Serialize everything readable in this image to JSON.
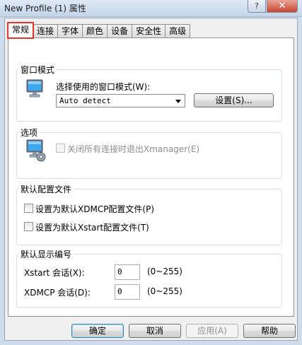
{
  "window": {
    "title": "New Profile (1) 属性",
    "help_button": "?",
    "close_button": "✕"
  },
  "tabs": [
    {
      "label": "常规"
    },
    {
      "label": "连接"
    },
    {
      "label": "字体"
    },
    {
      "label": "颜色"
    },
    {
      "label": "设备"
    },
    {
      "label": "安全性"
    },
    {
      "label": "高级"
    }
  ],
  "active_tab": "常规",
  "window_mode": {
    "group_label": "窗口模式",
    "select_label": "选择使用的窗口模式(W):",
    "select_value": "Auto detect",
    "settings_button": "设置(S)..."
  },
  "options": {
    "group_label": "选项",
    "exit_checkbox_label": "关闭所有连接时退出Xmanager(E)",
    "exit_checkbox_checked": false,
    "exit_checkbox_enabled": false
  },
  "default_profile": {
    "group_label": "默认配置文件",
    "xdmcp_checkbox_label": "设置为默认XDMCP配置文件(P)",
    "xdmcp_checked": false,
    "xstart_checkbox_label": "设置为默认Xstart配置文件(T)",
    "xstart_checked": false
  },
  "default_display": {
    "group_label": "默认显示编号",
    "xstart_label": "Xstart 会话(X):",
    "xstart_value": "0",
    "xstart_range": "(0~255)",
    "xdmcp_label": "XDMCP 会话(D):",
    "xdmcp_value": "0",
    "xdmcp_range": "(0~255)"
  },
  "footer": {
    "ok": "确定",
    "cancel": "取消",
    "apply": "应用(A)",
    "help": "帮助"
  },
  "icons": {
    "window_mode_icon": "monitor-icon",
    "options_icon": "monitor-gear-icon"
  }
}
